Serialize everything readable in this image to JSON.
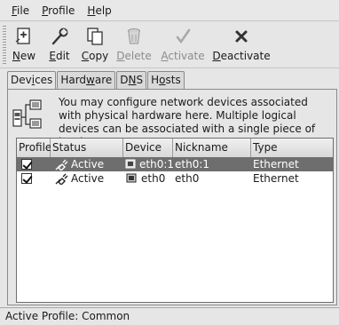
{
  "menubar": {
    "items": [
      {
        "label": "File",
        "mnemonic": "F",
        "rest": "ile"
      },
      {
        "label": "Profile",
        "mnemonic": "P",
        "rest": "rofile"
      },
      {
        "label": "Help",
        "mnemonic": "H",
        "rest": "elp"
      }
    ]
  },
  "toolbar": {
    "new": {
      "mnemonic": "N",
      "rest": "ew",
      "icon": "new-icon"
    },
    "edit": {
      "mnemonic": "E",
      "rest": "dit",
      "icon": "wrench-icon"
    },
    "copy": {
      "mnemonic": "C",
      "rest": "opy",
      "icon": "copy-icon"
    },
    "delete": {
      "mnemonic": "D",
      "rest": "elete",
      "icon": "trash-icon",
      "disabled": true
    },
    "activate": {
      "mnemonic": "A",
      "rest": "ctivate",
      "icon": "check-icon",
      "disabled": true
    },
    "deactivate": {
      "mnemonic": "D",
      "rest": "eactivate",
      "icon": "x-icon"
    }
  },
  "tabs": [
    {
      "pre": "Dev",
      "mnemonic": "i",
      "post": "ces"
    },
    {
      "pre": "Hard",
      "mnemonic": "w",
      "post": "are"
    },
    {
      "pre": "D",
      "mnemonic": "N",
      "post": "S"
    },
    {
      "pre": "H",
      "mnemonic": "o",
      "post": "sts"
    }
  ],
  "info_text": "You may configure network devices associated with physical hardware here.  Multiple logical devices can be associated with a single piece of hardware.",
  "table": {
    "headers": [
      "Profile",
      "Status",
      "Device",
      "Nickname",
      "Type"
    ],
    "rows": [
      {
        "profile": true,
        "status": "Active",
        "device": "eth0:1",
        "nickname": "eth0:1",
        "type": "Ethernet",
        "selected": true
      },
      {
        "profile": true,
        "status": "Active",
        "device": "eth0",
        "nickname": "eth0",
        "type": "Ethernet",
        "selected": false
      }
    ]
  },
  "statusbar": "Active Profile: Common"
}
